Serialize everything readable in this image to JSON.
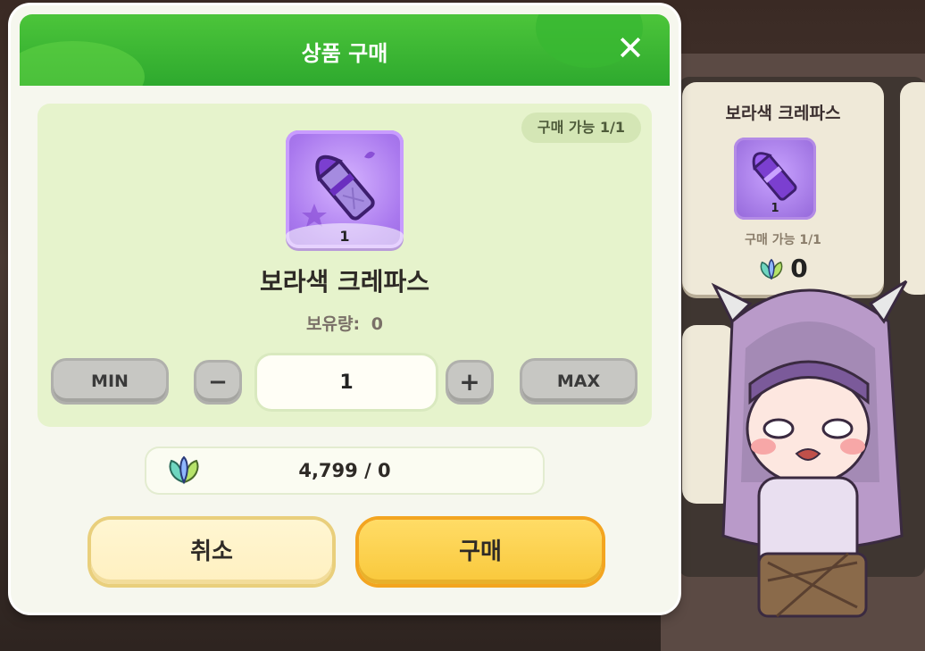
{
  "modal": {
    "title": "상품 구매",
    "close_icon": "close-icon",
    "purchase_limit": "구매 가능 1/1",
    "item": {
      "name": "보라색 크레파스",
      "stack_qty": "1",
      "owned_label": "보유량:",
      "owned_value": "0",
      "icon": "purple-crayon-icon"
    },
    "quantity": {
      "min_label": "MIN",
      "max_label": "MAX",
      "minus_label": "−",
      "plus_label": "+",
      "value": "1"
    },
    "cost": {
      "icon": "leaf-gem-icon",
      "text": "4,799 / 0"
    },
    "buttons": {
      "cancel_label": "취소",
      "buy_label": "구매"
    }
  },
  "background_shop": {
    "card": {
      "title": "보라색 크레파스",
      "stack_qty": "1",
      "limit": "구매 가능 1/1",
      "price": "0",
      "icon": "purple-crayon-icon",
      "price_icon": "leaf-gem-icon"
    }
  },
  "colors": {
    "header_green": "#2ea92e",
    "panel_green": "#e6f3cc",
    "buy_yellow": "#f9c83b",
    "cancel_cream": "#fff0c0",
    "crayon_purple": "#a978ee"
  }
}
